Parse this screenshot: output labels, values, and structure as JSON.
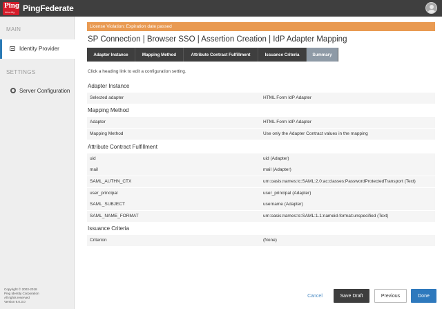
{
  "header": {
    "logo_line1": "Ping",
    "logo_line2": "Identity",
    "product": "PingFederate"
  },
  "sidebar": {
    "main_label": "MAIN",
    "settings_label": "SETTINGS",
    "items": [
      {
        "label": "Identity Provider",
        "icon": "id-card-icon",
        "active": true
      },
      {
        "label": "Server Configuration",
        "icon": "server-icon",
        "active": false
      }
    ],
    "copyright": [
      "Copyright © 2003-2018",
      "Ping Identity Corporation",
      "All rights reserved",
      "Version 9.0.3.0"
    ]
  },
  "banner": {
    "text": "License Violation: Expiration date passed",
    "color": "#e99a52"
  },
  "title": "SP Connection | Browser SSO | Assertion Creation | IdP Adapter Mapping",
  "tabs": [
    {
      "label": "Adapter Instance"
    },
    {
      "label": "Mapping Method"
    },
    {
      "label": "Attribute Contract Fulfillment"
    },
    {
      "label": "Issuance Criteria"
    },
    {
      "label": "Summary",
      "active": true
    }
  ],
  "hint": "Click a heading link to edit a configuration setting.",
  "sections": [
    {
      "heading": "Adapter Instance",
      "rows": [
        {
          "key": "Selected adapter",
          "value": "HTML Form IdP Adapter"
        }
      ]
    },
    {
      "heading": "Mapping Method",
      "rows": [
        {
          "key": "Adapter",
          "value": "HTML Form IdP Adapter"
        },
        {
          "key": "Mapping Method",
          "value": "Use only the Adapter Contract values in the mapping"
        }
      ]
    },
    {
      "heading": "Attribute Contract Fulfillment",
      "rows": [
        {
          "key": "uid",
          "value": "uid (Adapter)"
        },
        {
          "key": "mail",
          "value": "mail (Adapter)"
        },
        {
          "key": "SAML_AUTHN_CTX",
          "value": "urn:oasis:names:tc:SAML:2.0:ac:classes:PasswordProtectedTransport (Text)"
        },
        {
          "key": "user_principal",
          "value": "user_principal (Adapter)"
        },
        {
          "key": "SAML_SUBJECT",
          "value": "username (Adapter)"
        },
        {
          "key": "SAML_NAME_FORMAT",
          "value": "urn:oasis:names:tc:SAML:1.1:nameid-format:unspecified (Text)"
        }
      ]
    },
    {
      "heading": "Issuance Criteria",
      "rows": [
        {
          "key": "Criterion",
          "value": "(None)"
        }
      ]
    }
  ],
  "buttons": {
    "cancel": "Cancel",
    "save_draft": "Save Draft",
    "previous": "Previous",
    "done": "Done"
  }
}
